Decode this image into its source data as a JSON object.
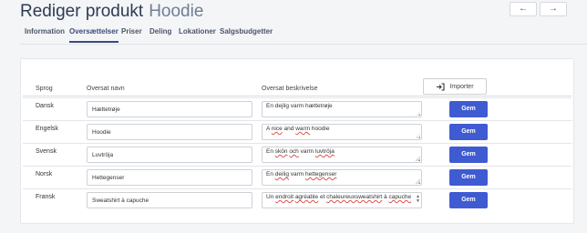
{
  "header": {
    "title": "Rediger produkt",
    "product": "Hoodie",
    "prev_icon": "arrow-left",
    "next_icon": "arrow-right",
    "prev_glyph": "←",
    "next_glyph": "→"
  },
  "tabs": [
    "Information",
    "Oversættelser",
    "Priser",
    "Deling",
    "Lokationer",
    "Salgsbudgetter"
  ],
  "active_tab": "Oversættelser",
  "table": {
    "columns": {
      "language": "Sprog",
      "name": "Oversat navn",
      "description": "Oversat beskrivelse"
    },
    "import_label": "Importer",
    "import_icon": "sign-in-icon",
    "save_label": "Gem",
    "rows": [
      {
        "language": "Dansk",
        "name": "Hættetrøje",
        "description": "En dejlig varm hættetrøje"
      },
      {
        "language": "Engelsk",
        "name": "Hoodie",
        "description": "A nice and warm hoodie"
      },
      {
        "language": "Svensk",
        "name": "Luvtröja",
        "description": "En skön och varm luvtröja"
      },
      {
        "language": "Norsk",
        "name": "Hettegenser",
        "description": "En deilig varm hettegenser"
      },
      {
        "language": "Fransk",
        "name": "Sweatshirt à capuche",
        "description": "Un endroit agréable et chaleureuxsweatshirt à capuche"
      }
    ]
  },
  "colors": {
    "accent": "#3f5bd2",
    "tab_active": "#3d4a7a"
  }
}
